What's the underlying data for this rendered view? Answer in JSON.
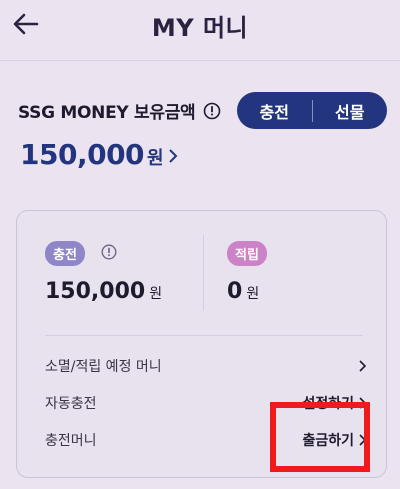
{
  "header": {
    "title": "MY 머니",
    "back_icon": "arrow-left-icon"
  },
  "balance": {
    "label": "SSG MONEY 보유금액",
    "amount": "150,000",
    "unit": "원",
    "buttons": {
      "charge": "충전",
      "gift": "선물"
    }
  },
  "card": {
    "charge": {
      "tag": "충전",
      "amount": "150,000",
      "unit": "원"
    },
    "points": {
      "tag": "적립",
      "amount": "0",
      "unit": "원"
    },
    "rows": [
      {
        "label": "소멸/적립 예정 머니",
        "action": ""
      },
      {
        "label": "자동충전",
        "action": "설정하기"
      },
      {
        "label": "충전머니",
        "action": "출금하기"
      }
    ]
  },
  "colors": {
    "brand": "#23357e",
    "charge_tag": "#8e86c6",
    "point_tag": "#cc82c6",
    "highlight": "#ef1a1a"
  }
}
